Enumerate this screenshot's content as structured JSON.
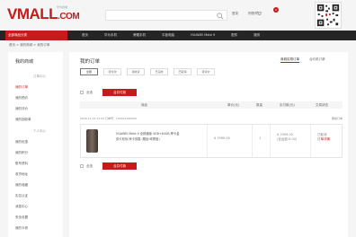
{
  "header": {
    "logo_main": "VMALL",
    "logo_suffix": ".COM",
    "logo_tag": "华为商城",
    "top_links": [
      "登录",
      "购物车"
    ],
    "cart_count": "0"
  },
  "nav": {
    "category_label": "全部商品分类",
    "items": [
      "首页",
      "华为手机",
      "荣耀手机",
      "平板电脑",
      "HUAWEI Mate 9",
      "配件",
      "服务"
    ]
  },
  "breadcrumb": "首页 > 我的商城 > 我的订单",
  "sidebar": {
    "title": "我的商城",
    "section_orders": "订单中心",
    "orders_items": [
      "我的订单",
      "我的预约",
      "我的评价",
      "我的回收单"
    ],
    "section_personal": "个人中心",
    "personal_items": [
      "我的优惠",
      "我的积分",
      "账号资料",
      "收货地址",
      "我的收藏",
      "实名认证",
      "消息中心",
      "安全设置",
      "我的卡券"
    ]
  },
  "content": {
    "title": "我的订单",
    "order_type_tabs": [
      "商城实物订单",
      "合约机订单"
    ],
    "status_tabs": [
      "全部",
      "待付款",
      "待收货",
      "已完成",
      "已取消",
      "待评价"
    ],
    "select_all_label": "全选",
    "merge_pay_label": "合并付款",
    "table_headers": {
      "product": "商品",
      "unit_price": "单价(元)",
      "quantity": "数量",
      "paid": "实付款(元)",
      "status": "交易状态"
    },
    "order": {
      "meta": "2016-12-19 13:23   订单号：101612190000",
      "delete_label": "删除订单",
      "product_line1": "HUAWEI Mate 9 全网通版 4GB+64GB 摩卡金",
      "product_line2": "双卡双待 徕卡双摄 (赠品:碎屏宝)",
      "unit_price": "¥ 3399.00",
      "quantity": "1",
      "paid_amount": "¥ 3399.00",
      "paid_note": "(含运费:0.00)",
      "status_text": "已取消",
      "status_link": "订单详情"
    }
  },
  "colors": {
    "accent": "#c51b1b",
    "nav_bg": "#252525",
    "page_bg": "#f5f5f5"
  }
}
